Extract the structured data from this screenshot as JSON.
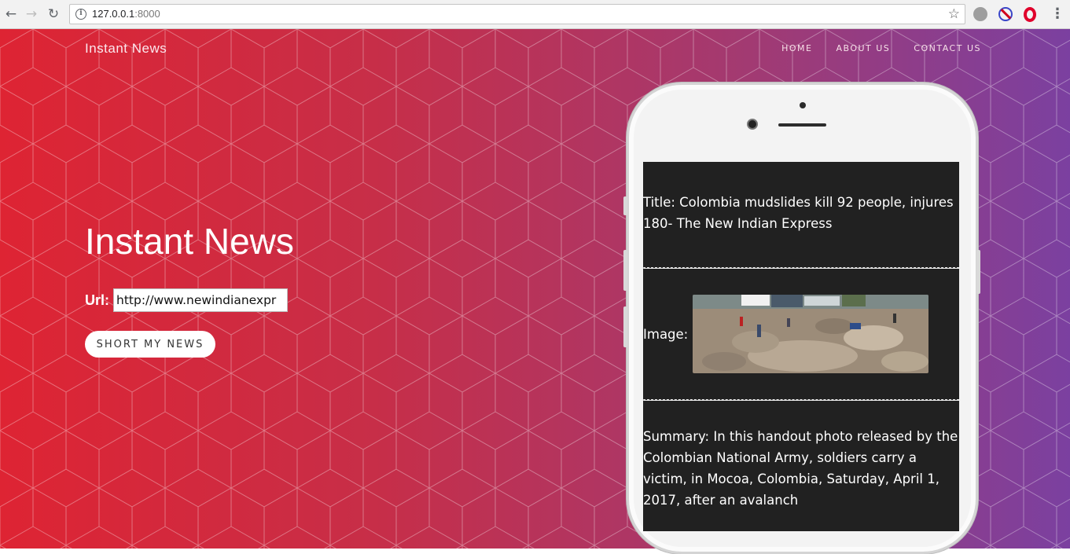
{
  "browser": {
    "url_host": "127.0.0.1",
    "url_port": ":8000"
  },
  "site": {
    "brand": "Instant News",
    "nav": [
      "HOME",
      "ABOUT US",
      "CONTACT US"
    ]
  },
  "hero": {
    "title": "Instant News",
    "url_label": "Url:",
    "url_value": "http://www.newindianexpr",
    "button_label": "SHORT MY NEWS"
  },
  "result": {
    "title_text": "Title: Colombia mudslides kill 92 people, injures 180- The New Indian Express",
    "image_label": "Image:",
    "summary_text": "Summary: In this handout photo released by the Colombian National Army, soldiers carry a victim, in Mocoa, Colombia, Saturday, April 1, 2017, after an avalanch"
  }
}
